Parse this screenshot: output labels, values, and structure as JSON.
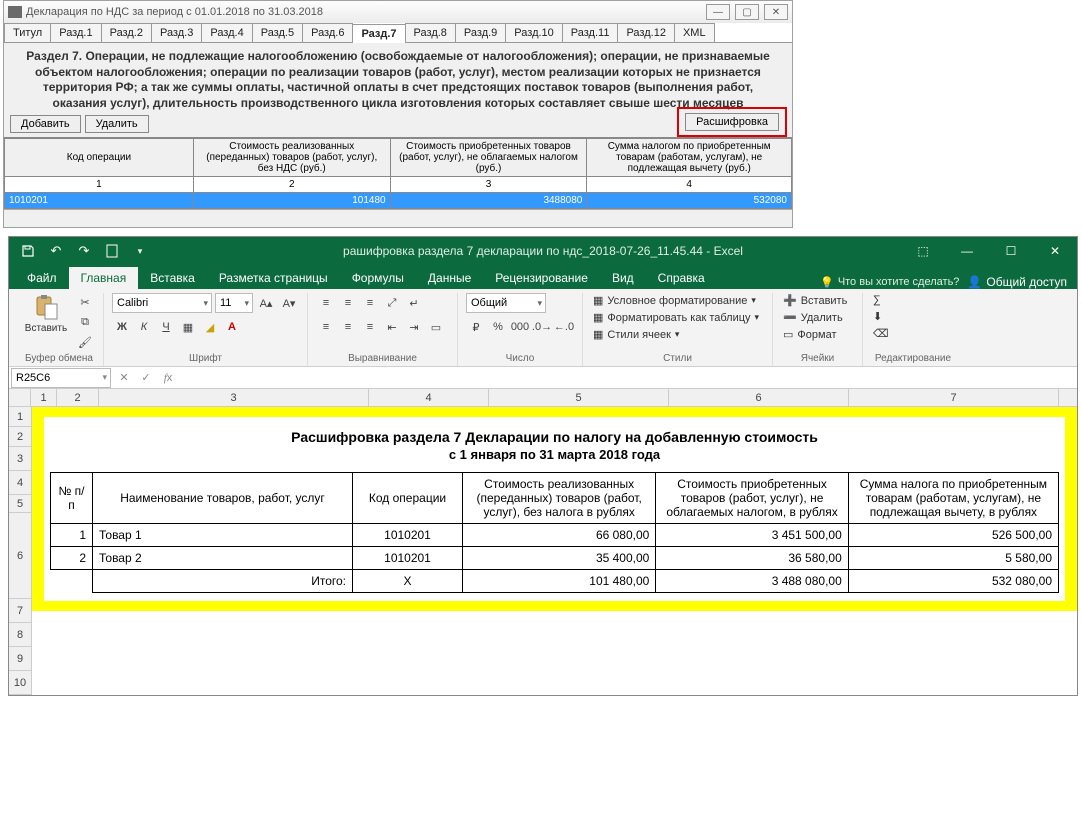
{
  "win1": {
    "title": "Декларация по НДС за период с 01.01.2018 по 31.03.2018",
    "tabs": [
      "Титул",
      "Разд.1",
      "Разд.2",
      "Разд.3",
      "Разд.4",
      "Разд.5",
      "Разд.6",
      "Разд.7",
      "Разд.8",
      "Разд.9",
      "Разд.10",
      "Разд.11",
      "Разд.12",
      "XML"
    ],
    "active_tab": 7,
    "section_title": "Раздел 7. Операции, не подлежащие налогообложению (освобождаемые от налогообложения); операции, не признаваемые объектом налогообложения; операции по реализации товаров (работ, услуг), местом реализации которых не признается территория РФ; а так же суммы оплаты, частичной оплаты в счет предстоящих поставок товаров (выполнения работ, оказания услуг), длительность производственного цикла изготовления которых составляет свыше шести месяцев",
    "btn_add": "Добавить",
    "btn_del": "Удалить",
    "btn_decode": "Расшифровка",
    "headers": [
      "Код операции",
      "Стоимость реализованных (переданных) товаров (работ, услуг), без НДС (руб.)",
      "Стоимость приобретенных товаров (работ, услуг), не облагаемых налогом (руб.)",
      "Сумма налогом по приобретенным товарам (работам, услугам), не подлежащая вычету (руб.)"
    ],
    "numrow": [
      "1",
      "2",
      "3",
      "4"
    ],
    "row": {
      "code": "1010201",
      "v1": "101480",
      "v2": "3488080",
      "v3": "532080"
    }
  },
  "excel": {
    "title": "рашифровка раздела 7 декларации по ндс_2018-07-26_11.45.44  -  Excel",
    "tabs": {
      "file": "Файл",
      "home": "Главная",
      "insert": "Вставка",
      "layout": "Разметка страницы",
      "formulas": "Формулы",
      "data": "Данные",
      "review": "Рецензирование",
      "view": "Вид",
      "help": "Справка"
    },
    "tellme": "Что вы хотите сделать?",
    "share": "Общий доступ",
    "groups": {
      "clipboard": "Буфер обмена",
      "font": "Шрифт",
      "align": "Выравнивание",
      "number": "Число",
      "styles": "Стили",
      "cells": "Ячейки",
      "editing": "Редактирование"
    },
    "paste": "Вставить",
    "font_name": "Calibri",
    "font_size": "11",
    "num_format": "Общий",
    "cond_fmt": "Условное форматирование",
    "as_table": "Форматировать как таблицу",
    "cell_styles": "Стили ячеек",
    "insert_btn": "Вставить",
    "delete_btn": "Удалить",
    "format_btn": "Формат",
    "namebox": "R25C6",
    "cols": [
      "1",
      "2",
      "3",
      "4",
      "5",
      "6",
      "7"
    ],
    "rows": [
      "1",
      "2",
      "3",
      "4",
      "5",
      "6",
      "7",
      "8",
      "9",
      "10"
    ],
    "report": {
      "title": "Расшифровка раздела 7 Декларации по налогу на добавленную стоимость",
      "sub": "с 1 января по 31 марта 2018 года",
      "headers": [
        "№ п/п",
        "Наименование товаров, работ, услуг",
        "Код операции",
        "Стоимость реализованных (переданных) товаров (работ, услуг), без налога в рублях",
        "Стоимость приобретенных товаров (работ, услуг), не облагаемых налогом, в рублях",
        "Сумма налога по приобретенным товарам (работам, услугам), не подлежащая вычету, в рублях"
      ],
      "rows": [
        {
          "n": "1",
          "name": "Товар 1",
          "code": "1010201",
          "v1": "66 080,00",
          "v2": "3 451 500,00",
          "v3": "526 500,00"
        },
        {
          "n": "2",
          "name": "Товар 2",
          "code": "1010201",
          "v1": "35 400,00",
          "v2": "36 580,00",
          "v3": "5 580,00"
        }
      ],
      "total_label": "Итого:",
      "total": {
        "code": "Х",
        "v1": "101 480,00",
        "v2": "3 488 080,00",
        "v3": "532 080,00"
      }
    }
  }
}
